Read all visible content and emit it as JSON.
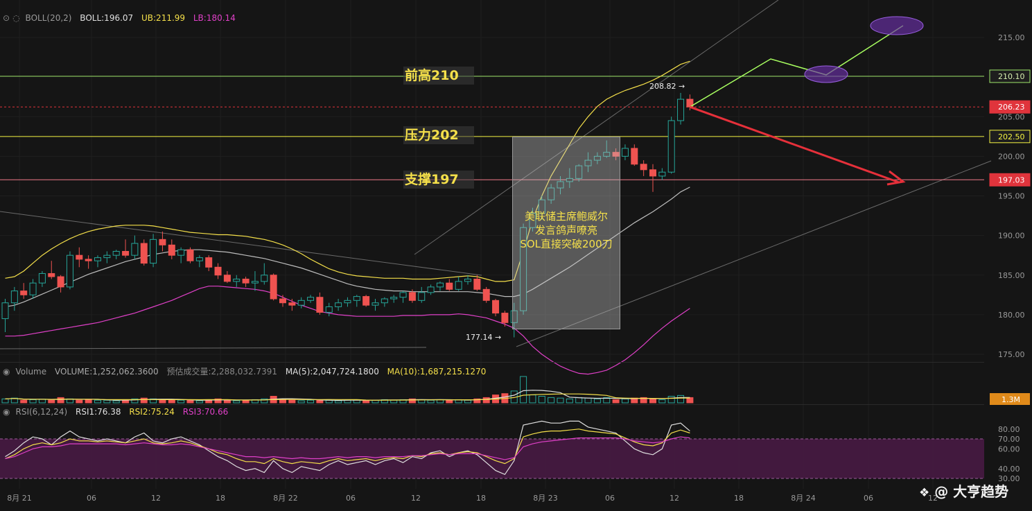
{
  "colors": {
    "background": "#151515",
    "up": "#26a69a",
    "down": "#ef5350",
    "boll_mid": "#bdbdbd",
    "boll_upper": "#f5e04a",
    "boll_lower": "#e040c8",
    "resistance_line": "#f5f542",
    "support_line": "#f07a8a",
    "prev_high_line": "#9ee86a",
    "projection_red": "#e6303a",
    "projection_green": "#a8ff60",
    "ellipse": "#6a2fa8"
  },
  "boll_header": {
    "name": "BOLL(20,2)",
    "boll_label": "BOLL:196.07",
    "ub_label": "UB:211.99",
    "lb_label": "LB:180.14"
  },
  "volume_header": {
    "name": "Volume",
    "volume_label": "VOLUME:1,252,062.3600",
    "est_label": "预估成交量:2,288,032.7391",
    "ma5_label": "MA(5):2,047,724.1800",
    "ma10_label": "MA(10):1,687,215.1270"
  },
  "rsi_header": {
    "name": "RSI(6,12,24)",
    "rsi1_label": "RSI1:76.38",
    "rsi2_label": "RSI2:75.24",
    "rsi3_label": "RSI3:70.66"
  },
  "price_axis": {
    "ticks": [
      "215.00",
      "205.00",
      "200.00",
      "195.00",
      "190.00",
      "185.00",
      "180.00",
      "175.00"
    ],
    "tick_values": [
      215,
      205,
      200,
      195,
      190,
      185,
      180,
      175
    ],
    "badges": [
      {
        "text": "210.10",
        "value": 210.1,
        "bg": "#1e1e1e",
        "fg": "#d8f0b0",
        "border": "#9ee86a"
      },
      {
        "text": "206.23",
        "value": 206.23,
        "bg": "#e0343c",
        "fg": "#ffffff",
        "border": "#e0343c"
      },
      {
        "text": "202.50",
        "value": 202.5,
        "bg": "#1e1e1e",
        "fg": "#f5f542",
        "border": "#f5f542"
      },
      {
        "text": "197.03",
        "value": 197.03,
        "bg": "#e0343c",
        "fg": "#ffffff",
        "border": "#e0343c"
      }
    ]
  },
  "volume_axis": {
    "badge": "1.3M"
  },
  "rsi_axis": {
    "ticks": [
      "80.00",
      "70.00",
      "60.00",
      "40.00",
      "30.00"
    ],
    "tick_values": [
      80,
      70,
      60,
      40,
      30
    ]
  },
  "time_axis": {
    "labels": [
      "8月 21",
      "06",
      "12",
      "18",
      "8月 22",
      "06",
      "12",
      "18",
      "8月 23",
      "06",
      "12",
      "18",
      "8月 24",
      "06",
      "12"
    ]
  },
  "annotations": {
    "prev_high": "前高210",
    "resistance": "压力202",
    "support": "支撑197",
    "news_line1": "美联储主席鲍威尔",
    "news_line2": "发言鸽声嘹亮",
    "news_line3": "SOL直接突破200刀",
    "high_marker": "208.82 →",
    "low_marker": "177.14 →"
  },
  "watermark": "@ 大亨趋势",
  "chart_data": {
    "type": "candlestick",
    "symbol_indicator": "BOLL(20,2)",
    "timeframe_hours": 1,
    "horizontal_levels": {
      "prev_high": 210.1,
      "resistance": 202.5,
      "support": 197.03,
      "last_price": 206.23
    },
    "ohlc": [
      [
        179.5,
        182.0,
        177.8,
        181.5
      ],
      [
        181.5,
        183.5,
        180.5,
        183.0
      ],
      [
        183.0,
        184.0,
        182.0,
        182.5
      ],
      [
        182.5,
        184.5,
        182.0,
        184.0
      ],
      [
        184.0,
        185.5,
        183.5,
        185.2
      ],
      [
        185.2,
        186.8,
        184.5,
        184.8
      ],
      [
        184.8,
        185.0,
        182.8,
        183.5
      ],
      [
        183.5,
        188.0,
        183.2,
        187.5
      ],
      [
        187.5,
        188.5,
        186.0,
        187.0
      ],
      [
        187.0,
        187.5,
        185.8,
        186.8
      ],
      [
        186.8,
        187.5,
        186.0,
        187.2
      ],
      [
        187.2,
        188.0,
        186.5,
        187.5
      ],
      [
        187.5,
        188.2,
        187.0,
        188.0
      ],
      [
        188.0,
        189.5,
        187.2,
        187.5
      ],
      [
        187.5,
        190.0,
        187.0,
        189.0
      ],
      [
        189.0,
        189.5,
        186.2,
        186.5
      ],
      [
        186.5,
        190.2,
        186.0,
        189.5
      ],
      [
        189.5,
        190.5,
        188.0,
        188.8
      ],
      [
        188.8,
        189.5,
        187.0,
        187.5
      ],
      [
        187.5,
        188.5,
        186.5,
        188.2
      ],
      [
        188.2,
        188.5,
        186.5,
        186.8
      ],
      [
        186.8,
        187.5,
        186.0,
        187.2
      ],
      [
        187.2,
        187.5,
        185.5,
        186.0
      ],
      [
        186.0,
        186.5,
        184.5,
        185.0
      ],
      [
        185.0,
        185.5,
        184.0,
        184.2
      ],
      [
        184.2,
        185.0,
        183.5,
        184.5
      ],
      [
        184.5,
        184.8,
        183.5,
        184.0
      ],
      [
        184.0,
        185.5,
        183.0,
        184.2
      ],
      [
        184.2,
        186.5,
        183.8,
        185.0
      ],
      [
        185.0,
        185.2,
        181.8,
        182.0
      ],
      [
        182.0,
        182.5,
        181.0,
        181.5
      ],
      [
        181.5,
        182.0,
        180.5,
        181.2
      ],
      [
        181.2,
        182.2,
        180.8,
        181.8
      ],
      [
        181.8,
        182.5,
        181.5,
        182.2
      ],
      [
        182.2,
        182.8,
        180.0,
        180.3
      ],
      [
        180.3,
        181.5,
        179.8,
        181.0
      ],
      [
        181.0,
        182.0,
        180.5,
        181.5
      ],
      [
        181.5,
        182.2,
        181.0,
        181.8
      ],
      [
        181.8,
        182.5,
        181.0,
        182.3
      ],
      [
        182.3,
        182.5,
        181.0,
        181.2
      ],
      [
        181.2,
        182.0,
        180.5,
        181.5
      ],
      [
        181.5,
        182.2,
        181.0,
        182.0
      ],
      [
        182.0,
        182.5,
        181.5,
        182.2
      ],
      [
        182.2,
        183.0,
        181.5,
        182.8
      ],
      [
        182.8,
        183.2,
        181.5,
        181.8
      ],
      [
        181.8,
        183.5,
        181.5,
        182.8
      ],
      [
        182.8,
        183.8,
        182.5,
        183.5
      ],
      [
        183.5,
        184.2,
        183.0,
        184.0
      ],
      [
        184.0,
        184.5,
        183.0,
        183.2
      ],
      [
        183.2,
        184.8,
        183.0,
        184.2
      ],
      [
        184.2,
        185.0,
        183.8,
        184.5
      ],
      [
        184.5,
        185.0,
        183.0,
        183.2
      ],
      [
        183.2,
        183.5,
        181.5,
        181.8
      ],
      [
        181.8,
        182.0,
        179.8,
        180.2
      ],
      [
        180.2,
        180.5,
        178.5,
        179.0
      ],
      [
        179.0,
        181.5,
        177.14,
        180.5
      ],
      [
        180.5,
        191.5,
        180.0,
        191.0
      ],
      [
        191.0,
        193.5,
        190.5,
        192.8
      ],
      [
        192.8,
        195.0,
        192.0,
        194.5
      ],
      [
        194.5,
        196.5,
        194.0,
        196.0
      ],
      [
        196.0,
        197.5,
        195.2,
        196.8
      ],
      [
        196.8,
        198.5,
        196.0,
        197.2
      ],
      [
        197.2,
        199.0,
        196.8,
        198.8
      ],
      [
        198.8,
        200.5,
        198.0,
        199.5
      ],
      [
        199.5,
        200.5,
        199.0,
        200.0
      ],
      [
        200.0,
        202.0,
        199.8,
        200.5
      ],
      [
        200.5,
        201.0,
        199.5,
        200.0
      ],
      [
        200.0,
        201.5,
        199.5,
        201.0
      ],
      [
        201.0,
        201.5,
        198.8,
        199.0
      ],
      [
        199.0,
        199.5,
        197.5,
        198.3
      ],
      [
        198.3,
        199.0,
        195.5,
        197.5
      ],
      [
        197.5,
        198.5,
        197.0,
        198.0
      ],
      [
        198.0,
        205.0,
        197.8,
        204.5
      ],
      [
        204.5,
        208.0,
        204.0,
        207.2
      ],
      [
        207.2,
        207.8,
        205.8,
        206.23
      ]
    ],
    "boll_mid": [
      181,
      181.2,
      181.6,
      182.1,
      182.6,
      183.1,
      183.6,
      184.1,
      184.6,
      185.1,
      185.5,
      185.9,
      186.3,
      186.7,
      187.0,
      187.3,
      187.6,
      187.8,
      188.0,
      188.1,
      188.2,
      188.2,
      188.1,
      188.0,
      187.9,
      187.7,
      187.5,
      187.3,
      187.1,
      186.8,
      186.5,
      186.2,
      185.9,
      185.5,
      185.1,
      184.7,
      184.3,
      183.9,
      183.6,
      183.4,
      183.2,
      183.1,
      183.0,
      183.0,
      182.9,
      182.9,
      182.9,
      182.9,
      182.9,
      182.9,
      182.9,
      182.8,
      182.7,
      182.5,
      182.3,
      182.3,
      182.6,
      183.2,
      183.9,
      184.6,
      185.3,
      186.0,
      186.8,
      187.6,
      188.4,
      189.2,
      190.0,
      190.8,
      191.6,
      192.3,
      193.0,
      193.8,
      194.6,
      195.5,
      196.1
    ],
    "boll_upper": [
      184.6,
      184.8,
      185.5,
      186.5,
      187.5,
      188.3,
      189.0,
      189.6,
      190.1,
      190.5,
      190.8,
      191.0,
      191.2,
      191.3,
      191.3,
      191.3,
      191.2,
      191.0,
      190.8,
      190.6,
      190.4,
      190.3,
      190.2,
      190.1,
      190.1,
      190.0,
      189.9,
      189.7,
      189.5,
      189.2,
      188.8,
      188.3,
      187.7,
      187.0,
      186.4,
      185.8,
      185.4,
      185.1,
      184.9,
      184.8,
      184.7,
      184.6,
      184.6,
      184.6,
      184.5,
      184.5,
      184.5,
      184.6,
      184.7,
      184.8,
      184.9,
      184.8,
      184.5,
      184.2,
      184.2,
      184.4,
      188.0,
      192.0,
      195.0,
      197.5,
      199.5,
      201.5,
      203.5,
      205.0,
      206.3,
      207.2,
      207.8,
      208.3,
      208.7,
      209.1,
      209.6,
      210.2,
      210.9,
      211.6,
      212.0
    ],
    "boll_lower": [
      177.3,
      177.3,
      177.4,
      177.6,
      177.8,
      178.0,
      178.2,
      178.4,
      178.6,
      178.8,
      179.0,
      179.3,
      179.6,
      179.9,
      180.2,
      180.6,
      181.0,
      181.4,
      181.8,
      182.3,
      182.8,
      183.3,
      183.6,
      183.6,
      183.5,
      183.4,
      183.3,
      183.2,
      183.0,
      182.7,
      182.2,
      181.7,
      181.2,
      180.8,
      180.4,
      180.2,
      180.0,
      179.9,
      179.8,
      179.8,
      179.8,
      179.8,
      179.8,
      179.9,
      179.9,
      179.9,
      180.0,
      180.0,
      180.0,
      180.1,
      180.0,
      179.8,
      179.6,
      179.2,
      178.8,
      178.3,
      177.3,
      176.0,
      175.0,
      174.2,
      173.5,
      173.0,
      172.6,
      172.5,
      172.7,
      173.0,
      173.6,
      174.3,
      175.2,
      176.2,
      177.3,
      178.3,
      179.2,
      180.0,
      180.8
    ],
    "volume_relative": [
      0.15,
      0.18,
      0.1,
      0.12,
      0.14,
      0.1,
      0.2,
      0.15,
      0.1,
      0.12,
      0.1,
      0.1,
      0.08,
      0.12,
      0.15,
      0.18,
      0.15,
      0.1,
      0.12,
      0.1,
      0.1,
      0.08,
      0.12,
      0.15,
      0.1,
      0.08,
      0.1,
      0.12,
      0.15,
      0.25,
      0.15,
      0.1,
      0.08,
      0.1,
      0.12,
      0.1,
      0.08,
      0.1,
      0.12,
      0.1,
      0.1,
      0.12,
      0.1,
      0.12,
      0.15,
      0.12,
      0.1,
      0.12,
      0.1,
      0.12,
      0.1,
      0.15,
      0.2,
      0.3,
      0.35,
      0.45,
      1.0,
      0.3,
      0.25,
      0.2,
      0.18,
      0.15,
      0.2,
      0.18,
      0.15,
      0.2,
      0.12,
      0.15,
      0.18,
      0.2,
      0.15,
      0.12,
      0.25,
      0.28,
      0.2
    ],
    "rsi1": [
      52,
      58,
      66,
      72,
      70,
      64,
      72,
      78,
      72,
      70,
      68,
      70,
      68,
      66,
      72,
      76,
      68,
      66,
      70,
      72,
      68,
      64,
      58,
      52,
      48,
      42,
      38,
      40,
      36,
      48,
      40,
      36,
      42,
      40,
      38,
      44,
      48,
      44,
      46,
      48,
      44,
      48,
      50,
      46,
      52,
      50,
      56,
      58,
      52,
      56,
      58,
      54,
      46,
      38,
      34,
      48,
      84,
      86,
      88,
      86,
      86,
      88,
      88,
      82,
      80,
      78,
      76,
      68,
      60,
      56,
      54,
      60,
      84,
      86,
      78
    ],
    "rsi2": [
      50,
      54,
      60,
      64,
      66,
      64,
      66,
      70,
      68,
      68,
      67,
      68,
      67,
      66,
      68,
      70,
      66,
      65,
      66,
      68,
      66,
      63,
      60,
      56,
      54,
      50,
      47,
      47,
      45,
      50,
      47,
      45,
      47,
      46,
      45,
      48,
      50,
      48,
      49,
      50,
      48,
      50,
      51,
      50,
      53,
      52,
      55,
      56,
      54,
      56,
      57,
      56,
      52,
      48,
      45,
      50,
      72,
      75,
      77,
      78,
      78,
      79,
      80,
      78,
      77,
      76,
      75,
      71,
      67,
      64,
      63,
      66,
      76,
      79,
      76
    ],
    "rsi3": [
      50,
      52,
      56,
      60,
      62,
      62,
      63,
      65,
      65,
      65,
      65,
      65,
      65,
      64,
      65,
      66,
      65,
      64,
      64,
      65,
      64,
      62,
      60,
      58,
      56,
      54,
      52,
      52,
      51,
      52,
      51,
      50,
      51,
      50,
      50,
      51,
      52,
      51,
      52,
      52,
      51,
      52,
      52,
      52,
      53,
      53,
      54,
      55,
      54,
      55,
      55,
      55,
      53,
      51,
      49,
      51,
      62,
      65,
      67,
      68,
      69,
      70,
      71,
      71,
      71,
      71,
      71,
      70,
      68,
      67,
      66,
      67,
      70,
      72,
      71
    ],
    "rsi_levels": {
      "upper": 70,
      "lower": 30
    }
  }
}
